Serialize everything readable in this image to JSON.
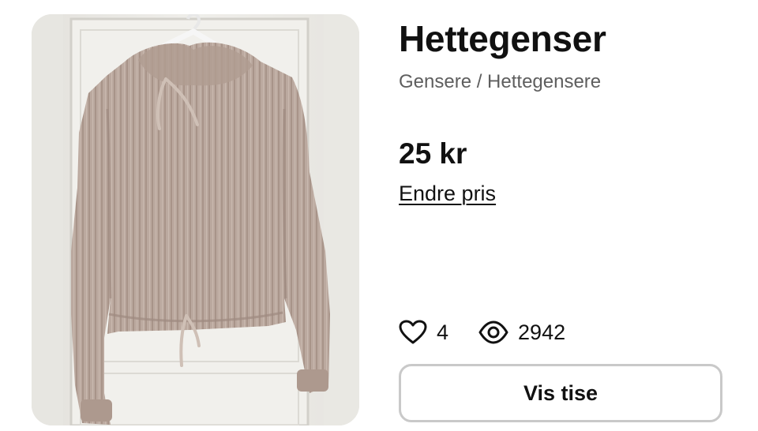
{
  "product": {
    "title": "Hettegenser",
    "category": "Gensere / Hettegensere",
    "price": "25 kr",
    "edit_price_label": "Endre pris",
    "image_alt": "hoodie-photo"
  },
  "stats": {
    "likes": "4",
    "likes_icon": "heart-icon",
    "views": "2942",
    "views_icon": "eye-icon"
  },
  "actions": {
    "show_button_label": "Vis tise"
  },
  "colors": {
    "text": "#111111",
    "muted": "#5e5e5e",
    "button_border": "#c9c9c9",
    "garment": "#b9a79d"
  }
}
